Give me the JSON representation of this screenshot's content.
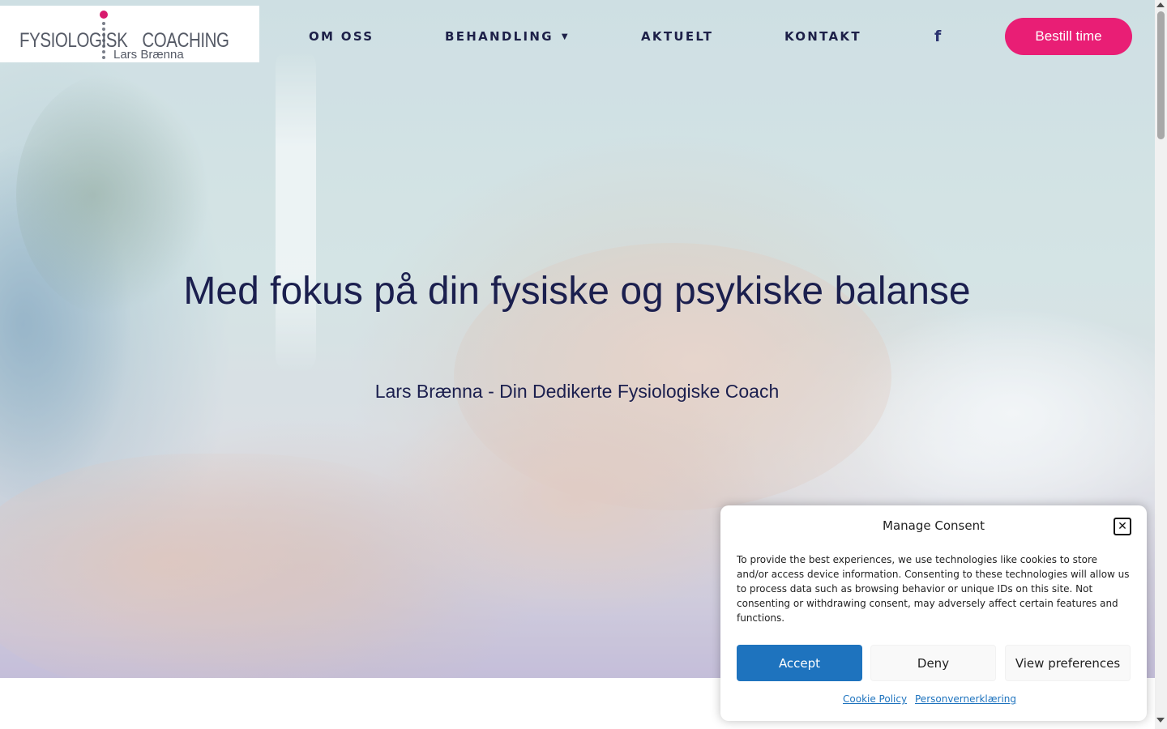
{
  "logo": {
    "word1": "FYSIOLOGISK",
    "word2": "COACHING",
    "sub": "Lars Brænna"
  },
  "nav": {
    "items": [
      "OM OSS",
      "BEHANDLING",
      "AKTUELT",
      "KONTAKT"
    ],
    "dropdown_icon": "chevron-down-icon",
    "social_icon": "facebook-icon",
    "cta": "Bestill time"
  },
  "hero": {
    "title": "Med fokus på din fysiske og psykiske balanse",
    "subtitle": "Lars Brænna - Din Dedikerte Fysiologiske Coach"
  },
  "consent": {
    "title": "Manage Consent",
    "text": "To provide the best experiences, we use technologies like cookies to store and/or access device information. Consenting to these technologies will allow us to process data such as browsing behavior or unique IDs on this site. Not consenting or withdrawing consent, may adversely affect certain features and functions.",
    "accept": "Accept",
    "deny": "Deny",
    "preferences": "View preferences",
    "links": [
      "Cookie Policy",
      "Personvernerklæring"
    ]
  },
  "colors": {
    "brand_pink": "#e91e75",
    "navy": "#1b1f4e",
    "accept_blue": "#1e73be"
  }
}
